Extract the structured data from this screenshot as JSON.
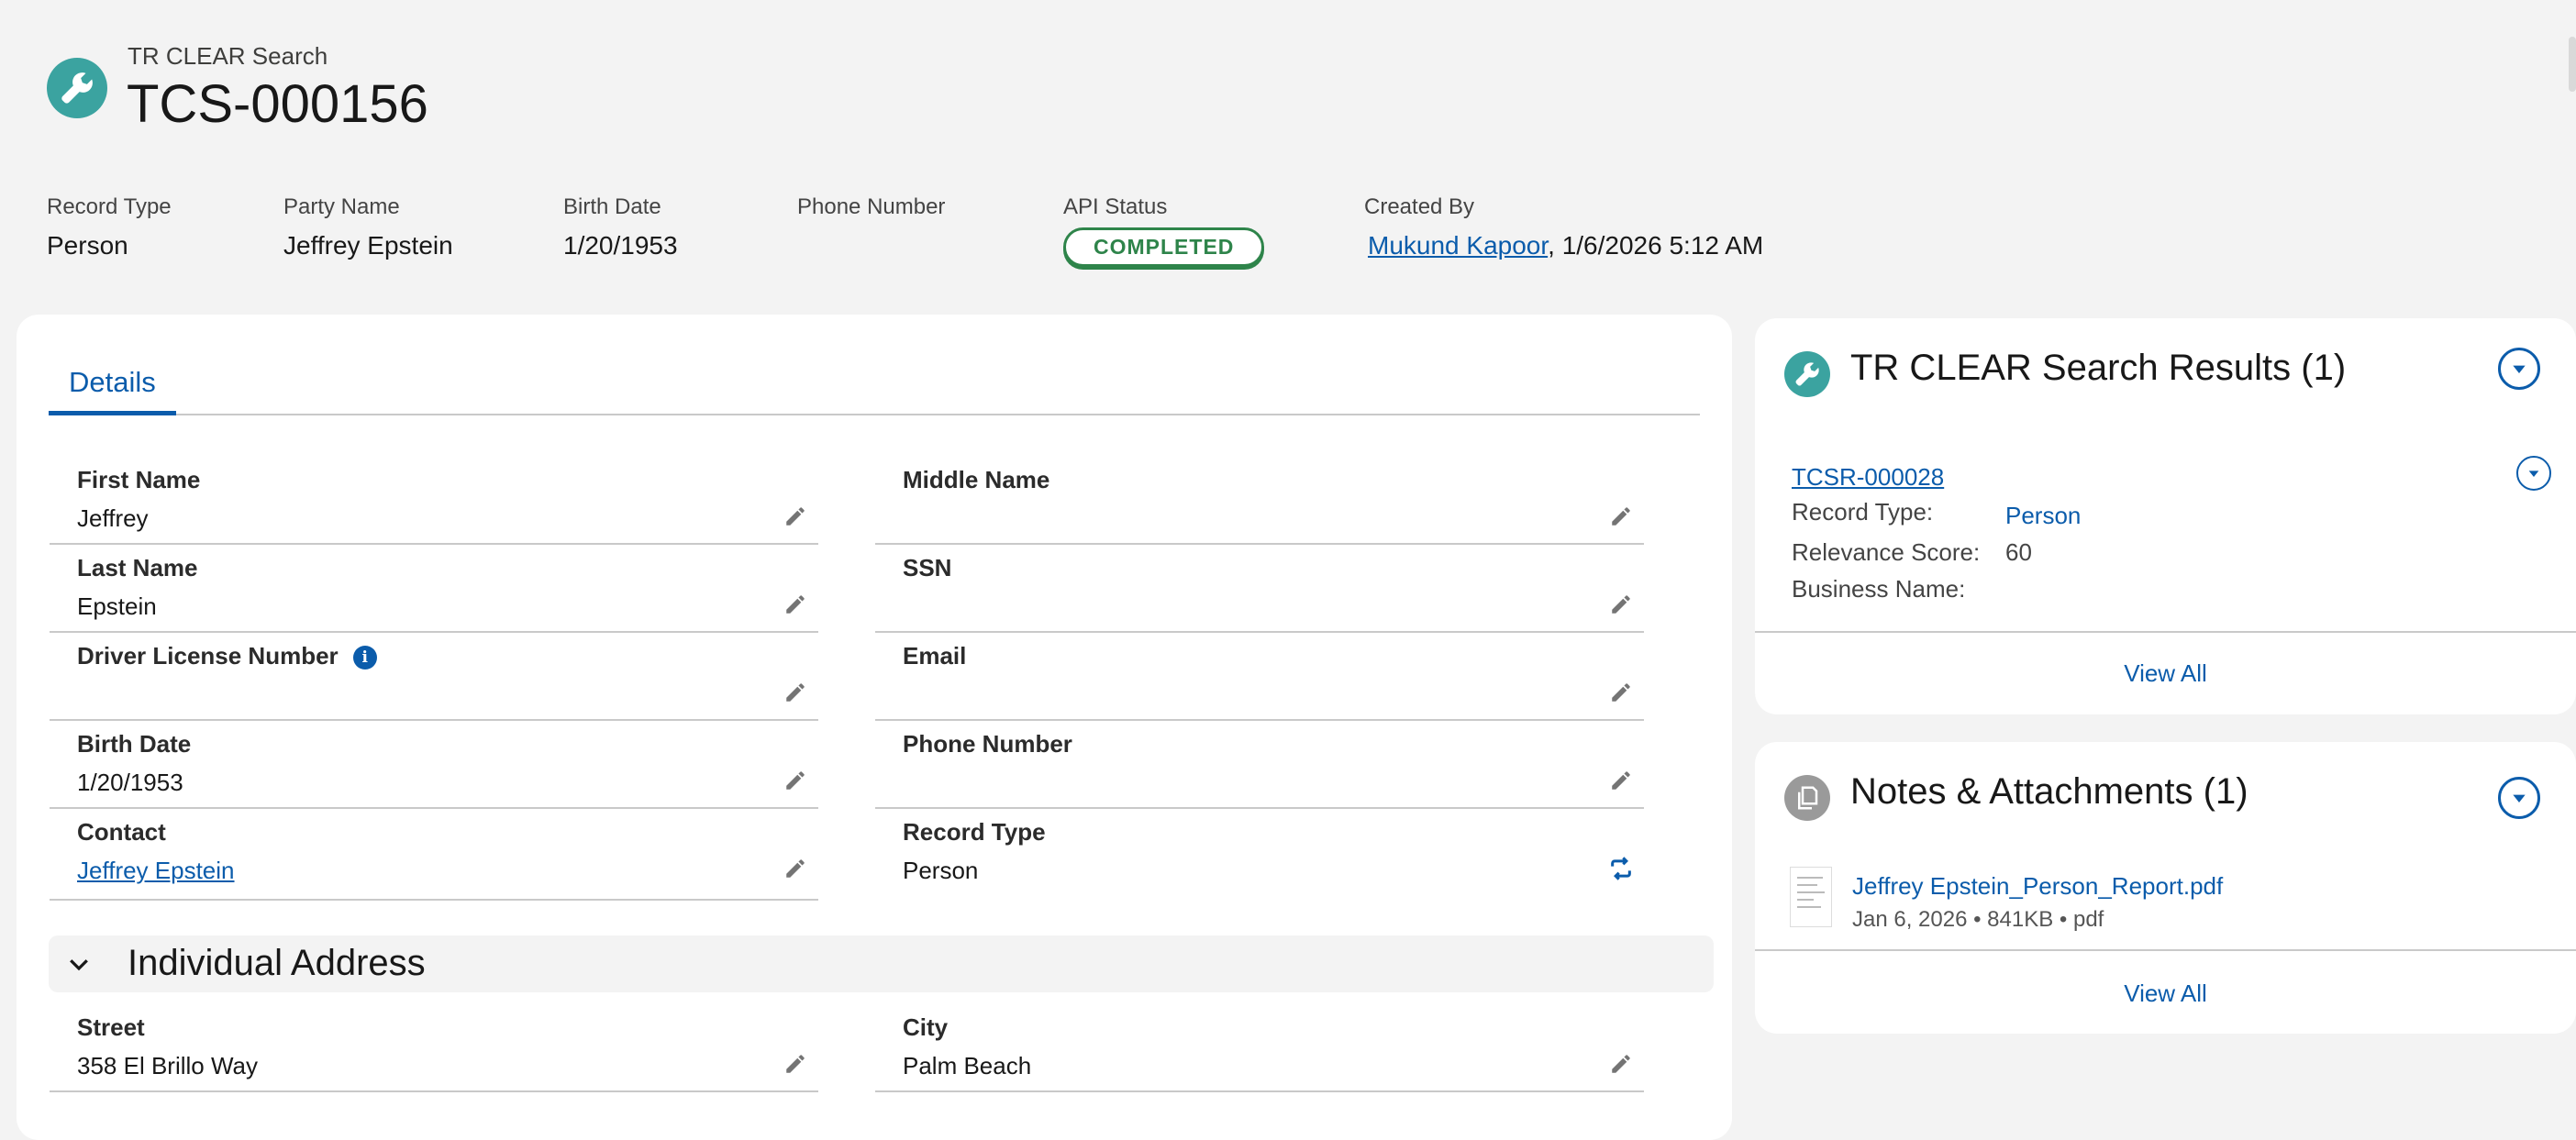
{
  "colors": {
    "brand_teal": "#3ba3a0",
    "link_blue": "#0b5cab",
    "status_green": "#2e844a",
    "notes_gray": "#9a9a9a"
  },
  "header": {
    "object_type": "TR CLEAR Search",
    "record_name": "TCS-000156",
    "icon": "wrench-icon"
  },
  "highlights": {
    "record_type": {
      "label": "Record Type",
      "value": "Person"
    },
    "party_name": {
      "label": "Party Name",
      "value": "Jeffrey Epstein"
    },
    "birth_date": {
      "label": "Birth Date",
      "value": "1/20/1953"
    },
    "phone_number": {
      "label": "Phone Number",
      "value": ""
    },
    "api_status": {
      "label": "API Status",
      "value": "COMPLETED"
    },
    "created_by": {
      "label": "Created By",
      "user": "Mukund Kapoor",
      "separator": ",",
      "timestamp": "1/6/2026 5:12 AM"
    }
  },
  "tabs": {
    "details": "Details"
  },
  "fields": {
    "first_name": {
      "label": "First Name",
      "value": "Jeffrey"
    },
    "middle_name": {
      "label": "Middle Name",
      "value": ""
    },
    "last_name": {
      "label": "Last Name",
      "value": "Epstein"
    },
    "ssn": {
      "label": "SSN",
      "value": ""
    },
    "driver_license": {
      "label": "Driver License Number",
      "value": ""
    },
    "email": {
      "label": "Email",
      "value": ""
    },
    "birth_date": {
      "label": "Birth Date",
      "value": "1/20/1953"
    },
    "phone_number": {
      "label": "Phone Number",
      "value": ""
    },
    "contact": {
      "label": "Contact",
      "value": "Jeffrey Epstein"
    },
    "record_type": {
      "label": "Record Type",
      "value": "Person"
    },
    "street": {
      "label": "Street",
      "value": "358 El Brillo Way"
    },
    "city": {
      "label": "City",
      "value": "Palm Beach"
    }
  },
  "sections": {
    "individual_address": "Individual Address"
  },
  "search_results": {
    "title": "TR CLEAR Search Results (1)",
    "icon": "wrench-icon",
    "item": {
      "name": "TCSR-000028",
      "record_type_label": "Record Type:",
      "record_type_value": "Person",
      "relevance_label": "Relevance Score:",
      "relevance_value": "60",
      "business_label": "Business Name:",
      "business_value": ""
    },
    "view_all": "View All"
  },
  "notes": {
    "title": "Notes & Attachments (1)",
    "icon": "files-icon",
    "file": {
      "name": "Jeffrey Epstein_Person_Report.pdf",
      "meta": "Jan 6, 2026 • 841KB • pdf"
    },
    "view_all": "View All"
  }
}
